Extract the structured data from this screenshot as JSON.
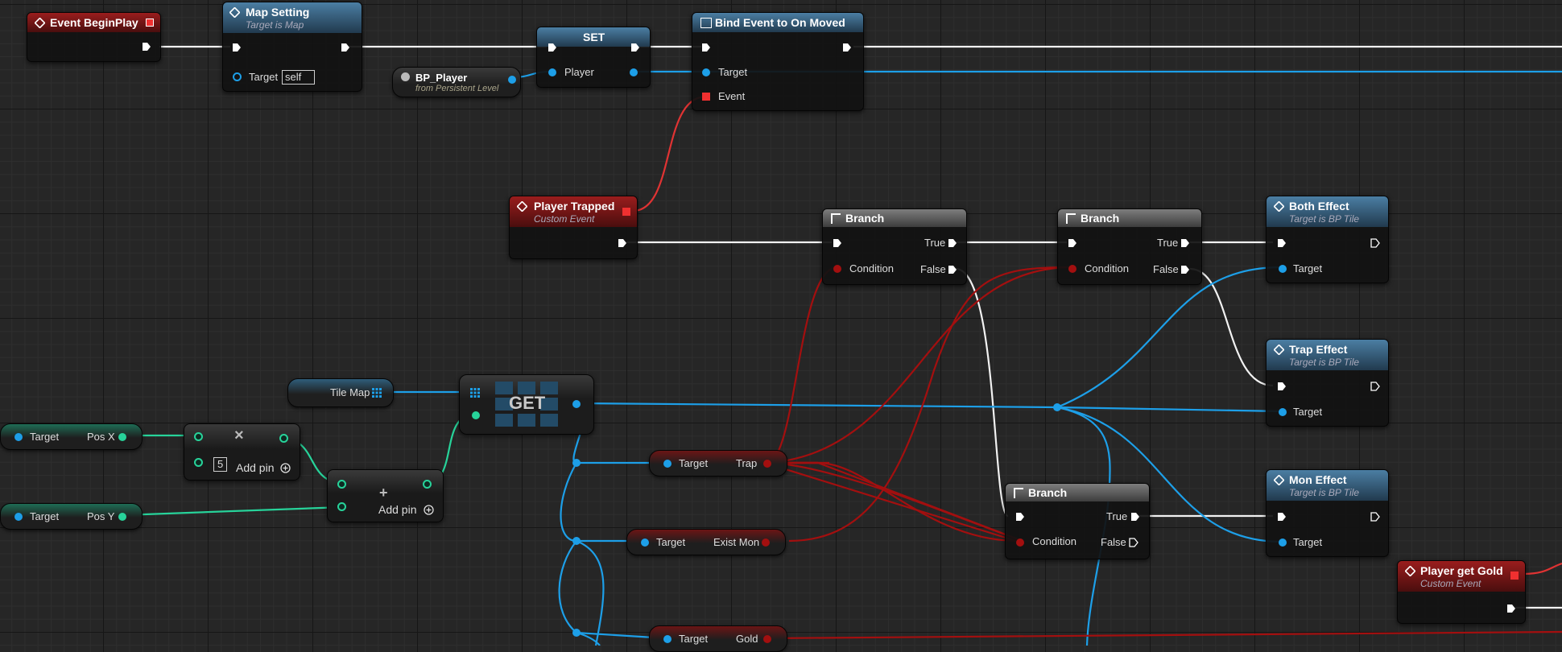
{
  "colors": {
    "exec": "#ffffff",
    "object": "#1d9fe8",
    "integer": "#27d39a",
    "boolean": "#a30f0f",
    "event": "#f03030"
  },
  "nodes": {
    "event_begin_play": {
      "title": "Event BeginPlay"
    },
    "map_setting": {
      "title": "Map Setting",
      "subtitle": "Target is Map",
      "target_label": "Target",
      "target_value": "self"
    },
    "bp_player": {
      "title": "BP_Player",
      "subtitle": "from Persistent Level"
    },
    "set_node": {
      "title": "SET",
      "pin_label": "Player"
    },
    "bind_event": {
      "title": "Bind Event to On Moved",
      "target_label": "Target",
      "event_label": "Event"
    },
    "player_trapped": {
      "title": "Player Trapped",
      "subtitle": "Custom Event"
    },
    "branch1": {
      "title": "Branch",
      "condition": "Condition",
      "true_label": "True",
      "false_label": "False"
    },
    "branch2": {
      "title": "Branch",
      "condition": "Condition",
      "true_label": "True",
      "false_label": "False"
    },
    "branch3": {
      "title": "Branch",
      "condition": "Condition",
      "true_label": "True",
      "false_label": "False"
    },
    "both_effect": {
      "title": "Both Effect",
      "subtitle": "Target is BP Tile",
      "target_label": "Target"
    },
    "trap_effect": {
      "title": "Trap Effect",
      "subtitle": "Target is BP Tile",
      "target_label": "Target"
    },
    "mon_effect": {
      "title": "Mon Effect",
      "subtitle": "Target is BP Tile",
      "target_label": "Target"
    },
    "player_get_gold": {
      "title": "Player get Gold",
      "subtitle": "Custom Event"
    },
    "tile_map": {
      "title": "Tile Map"
    },
    "get_node": {
      "title": "GET"
    },
    "pos_x": {
      "target_label": "Target",
      "value_label": "Pos X"
    },
    "pos_y": {
      "target_label": "Target",
      "value_label": "Pos Y"
    },
    "multiply": {
      "value": "5",
      "add_pin": "Add pin"
    },
    "add": {
      "add_pin": "Add pin"
    },
    "trap_get": {
      "target_label": "Target",
      "value_label": "Trap"
    },
    "exist_mon_get": {
      "target_label": "Target",
      "value_label": "Exist Mon"
    },
    "gold_get": {
      "target_label": "Target",
      "value_label": "Gold"
    }
  },
  "icons": {
    "event": "event-diamond-icon",
    "function": "function-icon",
    "branch": "branch-icon",
    "multiply": "multiply-icon",
    "add": "plus-icon",
    "array": "array-grid-icon",
    "add_pin": "add-pin-icon",
    "actor": "actor-icon"
  }
}
